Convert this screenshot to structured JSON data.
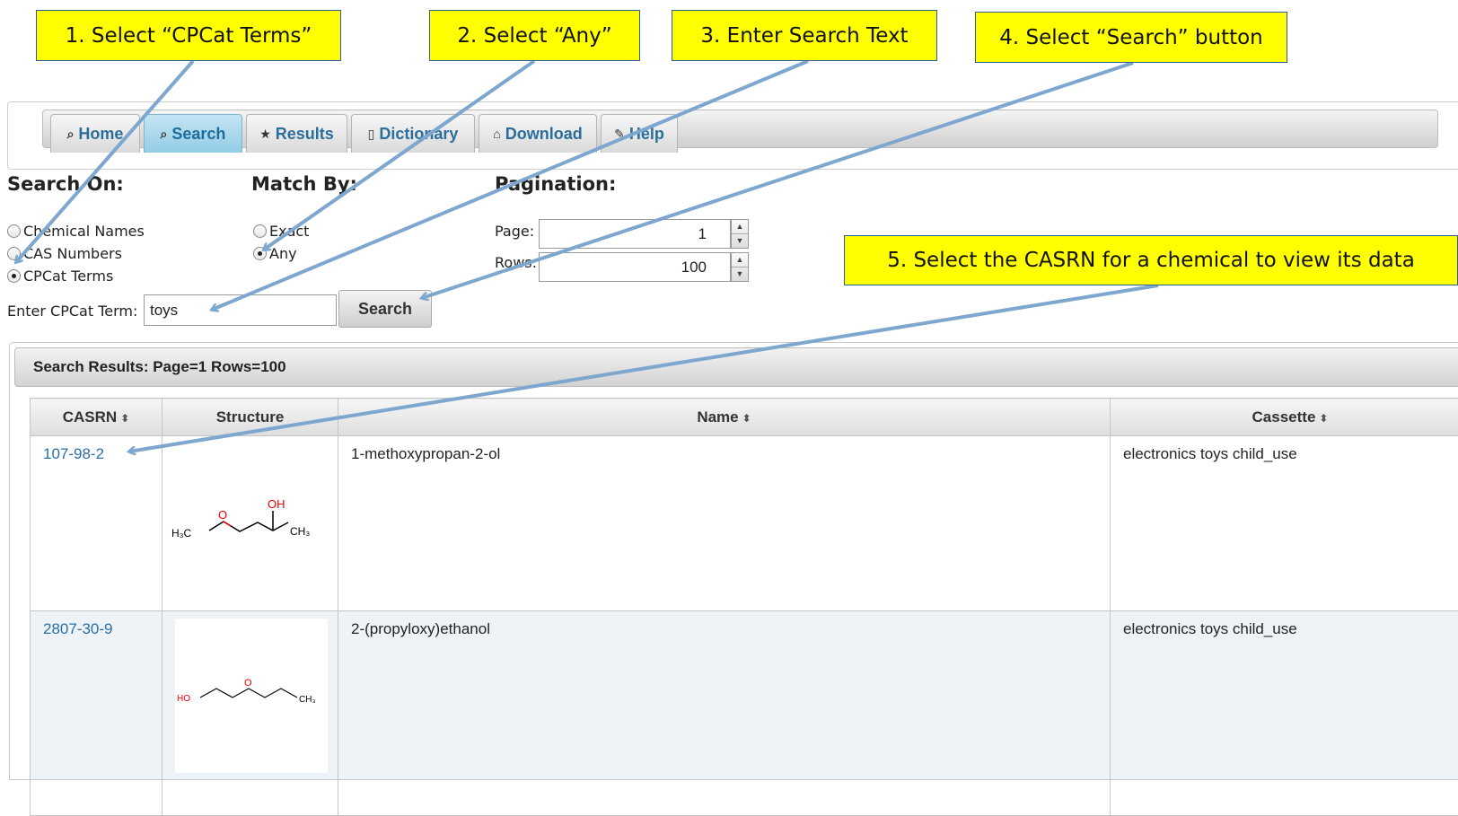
{
  "callouts": {
    "step1": "1. Select “CPCat Terms”",
    "step2": "2. Select “Any”",
    "step3": "3. Enter Search Text",
    "step4": "4. Select “Search” button",
    "step5": "5. Select the CASRN for a chemical to view its data"
  },
  "nav": {
    "tabs": [
      {
        "label": "Home",
        "icon": "search-icon",
        "glyph": "⌕"
      },
      {
        "label": "Search",
        "icon": "search-icon",
        "glyph": "⌕"
      },
      {
        "label": "Results",
        "icon": "star-icon",
        "glyph": "★"
      },
      {
        "label": "Dictionary",
        "icon": "document-icon",
        "glyph": "🗋"
      },
      {
        "label": "Download",
        "icon": "home-icon",
        "glyph": "⌂"
      },
      {
        "label": "Help",
        "icon": "wrench-icon",
        "glyph": "✎"
      }
    ],
    "active": "Search"
  },
  "search_on": {
    "title": "Search On:",
    "options": [
      "Chemical Names",
      "CAS Numbers",
      "CPCat Terms"
    ],
    "selected": "CPCat Terms"
  },
  "match_by": {
    "title": "Match By:",
    "options": [
      "Exact",
      "Any"
    ],
    "selected": "Any"
  },
  "pagination": {
    "title": "Pagination:",
    "page_label": "Page:",
    "page_value": "1",
    "rows_label": "Rows:",
    "rows_value": "100"
  },
  "search_input": {
    "label": "Enter CPCat Term:",
    "value": "toys",
    "button": "Search"
  },
  "results": {
    "header": "Search Results: Page=1 Rows=100",
    "columns": [
      "CASRN",
      "Structure",
      "Name",
      "Cassette"
    ],
    "rows": [
      {
        "casrn": "107-98-2",
        "name": "1-methoxypropan-2-ol",
        "cassette": "electronics toys child_use",
        "struct_labels": {
          "a": "OH",
          "b": "H₃C",
          "c": "O",
          "d": "CH₃"
        }
      },
      {
        "casrn": "2807-30-9",
        "name": "2-(propyloxy)ethanol",
        "cassette": "electronics toys child_use",
        "struct_labels": {
          "a": "HO",
          "b": "O",
          "c": "CH₃"
        }
      }
    ]
  },
  "colors": {
    "callout_bg": "#ffff00",
    "arrow": "#7ea7cf",
    "link": "#2a6fa3",
    "active_tab": "#93cce6"
  }
}
